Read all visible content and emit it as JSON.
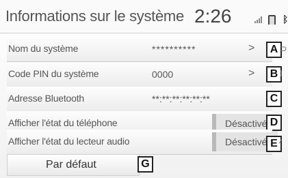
{
  "header": {
    "title": "Informations sur le système",
    "clock": "2:26"
  },
  "rows": [
    {
      "label": "Nom du système",
      "value": "**********",
      "chevron": ">",
      "callout": "A"
    },
    {
      "label": "Code PIN du système",
      "value": "0000",
      "chevron": ">",
      "callout": "B"
    },
    {
      "label": "Adresse Bluetooth",
      "value": "**:**:**:**:**:**",
      "callout": "C"
    },
    {
      "label": "Afficher l'état du téléphone",
      "toggle": "Désactivé",
      "callout": "D"
    },
    {
      "label": "Afficher l'état du lecteur audio",
      "toggle": "Désactivé",
      "callout": "E"
    }
  ],
  "default_button": {
    "label": "Par défaut",
    "callout": "G"
  },
  "icons": {
    "signal": "signal-strength-icon",
    "phone": "phone-battery-icon",
    "bluetooth": "bluetooth-icon"
  },
  "colors": {
    "text": "#555555",
    "callout_border": "#222222",
    "toggle_indicator": "#b9b9b9"
  }
}
